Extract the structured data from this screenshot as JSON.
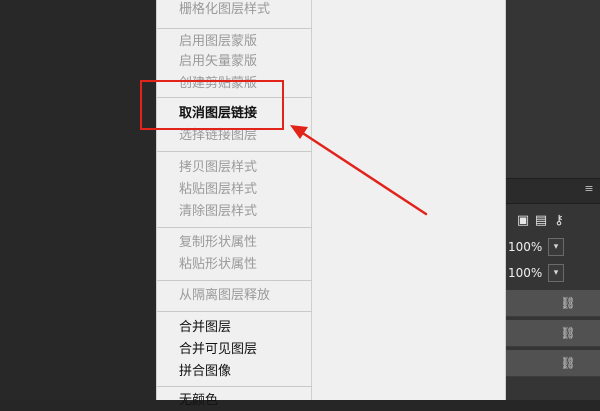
{
  "menu": {
    "items": [
      {
        "label": "栅格化图层样式",
        "enabled": false
      },
      {
        "label": "启用图层蒙版",
        "enabled": false
      },
      {
        "label": "启用矢量蒙版",
        "enabled": false
      },
      {
        "label": "创建剪贴蒙版",
        "enabled": false
      },
      {
        "label": "取消图层链接",
        "enabled": true
      },
      {
        "label": "选择链接图层",
        "enabled": false
      },
      {
        "label": "拷贝图层样式",
        "enabled": false
      },
      {
        "label": "粘贴图层样式",
        "enabled": false
      },
      {
        "label": "清除图层样式",
        "enabled": false
      },
      {
        "label": "复制形状属性",
        "enabled": false
      },
      {
        "label": "粘贴形状属性",
        "enabled": false
      },
      {
        "label": "从隔离图层释放",
        "enabled": false
      },
      {
        "label": "合并图层",
        "enabled": true
      },
      {
        "label": "合并可见图层",
        "enabled": true
      },
      {
        "label": "拼合图像",
        "enabled": true
      },
      {
        "label": "无颜色",
        "enabled": true
      }
    ]
  },
  "layers_panel": {
    "opacity": "100%",
    "fill": "100%",
    "icons": {
      "panel_menu": "panel-menu-icon",
      "lock": "lock-icon",
      "link": "link-icon"
    }
  },
  "annotation": {
    "color": "#e2231a"
  }
}
